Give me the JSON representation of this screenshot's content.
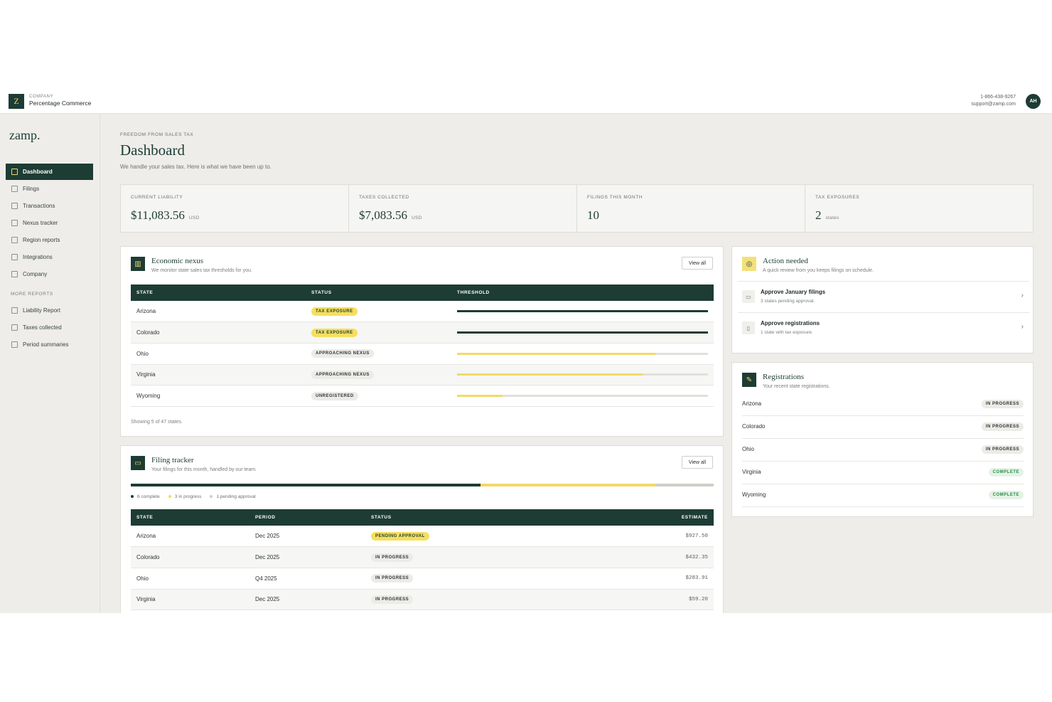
{
  "topbar": {
    "logo_letter": "Z",
    "company_label": "COMPANY",
    "company_name": "Percentage Commerce",
    "phone": "1-866-438-9267",
    "email": "support@zamp.com",
    "avatar_initials": "AH"
  },
  "sidebar": {
    "brand": "zamp.",
    "items": [
      {
        "label": "Dashboard",
        "icon": "grid-icon",
        "active": true
      },
      {
        "label": "Filings",
        "icon": "folder-icon"
      },
      {
        "label": "Transactions",
        "icon": "list-icon"
      },
      {
        "label": "Nexus tracker",
        "icon": "map-icon"
      },
      {
        "label": "Region reports",
        "icon": "document-icon"
      },
      {
        "label": "Integrations",
        "icon": "grid-icon"
      },
      {
        "label": "Company",
        "icon": "users-icon"
      }
    ],
    "section_label": "MORE REPORTS",
    "reports": [
      {
        "label": "Liability Report",
        "icon": "document-icon"
      },
      {
        "label": "Taxes collected",
        "icon": "document-icon"
      },
      {
        "label": "Period summaries",
        "icon": "document-icon"
      }
    ]
  },
  "header": {
    "eyebrow": "FREEDOM FROM SALES TAX",
    "title": "Dashboard",
    "subtitle": "We handle your sales tax. Here is what we have been up to."
  },
  "stats": [
    {
      "label": "CURRENT LIABILITY",
      "value": "$11,083.56",
      "unit": "USD"
    },
    {
      "label": "TAXES COLLECTED",
      "value": "$7,083.56",
      "unit": "USD"
    },
    {
      "label": "FILINGS THIS MONTH",
      "value": "10",
      "unit": ""
    },
    {
      "label": "TAX EXPOSURES",
      "value": "2",
      "unit": "states"
    }
  ],
  "nexus": {
    "title": "Economic nexus",
    "subtitle": "We monitor state sales tax thresholds for you.",
    "view_all": "View all",
    "columns": [
      "STATE",
      "STATUS",
      "THRESHOLD"
    ],
    "rows": [
      {
        "state": "Arizona",
        "status": "TAX EXPOSURE",
        "tone": "yellow",
        "threshold": 1.0,
        "color": "#1d3c34"
      },
      {
        "state": "Colorado",
        "status": "TAX EXPOSURE",
        "tone": "yellow",
        "threshold": 1.0,
        "color": "#1d3c34"
      },
      {
        "state": "Ohio",
        "status": "APPROACHING NEXUS",
        "tone": "grey",
        "threshold": 0.79,
        "color": "#f3d96a"
      },
      {
        "state": "Virginia",
        "status": "APPROACHING NEXUS",
        "tone": "grey",
        "threshold": 0.74,
        "color": "#f3d96a"
      },
      {
        "state": "Wyoming",
        "status": "UNREGISTERED",
        "tone": "grey",
        "threshold": 0.18,
        "color": "#f3d96a"
      }
    ],
    "footnote": "Showing 5 of 47 states."
  },
  "filing": {
    "title": "Filing tracker",
    "subtitle": "Your filings for this month, handled by our team.",
    "view_all": "View all",
    "progress": {
      "complete": 0.6,
      "in_progress": 0.3,
      "pending": 0.1
    },
    "legend": [
      "6 complete",
      "3 in progress",
      "1 pending approval"
    ],
    "columns": [
      "STATE",
      "PERIOD",
      "STATUS",
      "ESTIMATE"
    ],
    "rows": [
      {
        "state": "Arizona",
        "period": "Dec 2025",
        "status": "PENDING APPROVAL",
        "tone": "yellow",
        "estimate": "$927.50"
      },
      {
        "state": "Colorado",
        "period": "Dec 2025",
        "status": "IN PROGRESS",
        "tone": "grey",
        "estimate": "$432.35"
      },
      {
        "state": "Ohio",
        "period": "Q4 2025",
        "status": "IN PROGRESS",
        "tone": "grey",
        "estimate": "$283.91"
      },
      {
        "state": "Virginia",
        "period": "Dec 2025",
        "status": "IN PROGRESS",
        "tone": "grey",
        "estimate": "$59.20"
      }
    ]
  },
  "actions": {
    "title": "Action needed",
    "subtitle": "A quick review from you keeps filings on schedule.",
    "items": [
      {
        "title": "Approve January filings",
        "sub": "3 states pending approval.",
        "icon": "folder-icon"
      },
      {
        "title": "Approve registrations",
        "sub": "1 state with tax exposure.",
        "icon": "document-icon"
      }
    ]
  },
  "registrations": {
    "title": "Registrations",
    "subtitle": "Your recent state registrations.",
    "items": [
      {
        "state": "Arizona",
        "status": "IN PROGRESS",
        "tone": "grey"
      },
      {
        "state": "Colorado",
        "status": "IN PROGRESS",
        "tone": "grey"
      },
      {
        "state": "Ohio",
        "status": "IN PROGRESS",
        "tone": "grey"
      },
      {
        "state": "Virginia",
        "status": "COMPLETE",
        "tone": "green"
      },
      {
        "state": "Wyoming",
        "status": "COMPLETE",
        "tone": "green"
      }
    ]
  }
}
